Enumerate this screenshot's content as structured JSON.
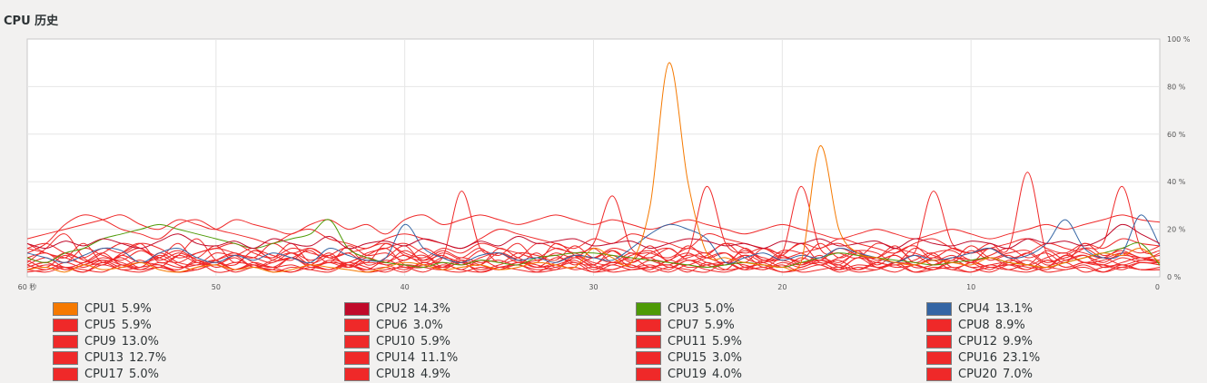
{
  "window": {
    "section_title": "CPU 历史"
  },
  "chart_data": {
    "type": "line",
    "title": "CPU 历史",
    "x_ticks": [
      "60 秒",
      "50",
      "40",
      "30",
      "20",
      "10",
      "0"
    ],
    "y_ticks": [
      "0 %",
      "20 %",
      "40 %",
      "60 %",
      "80 %",
      "100 %"
    ],
    "xlim": [
      60,
      0
    ],
    "ylim": [
      0,
      100
    ],
    "grid": true,
    "legend_position": "bottom",
    "x": [
      60,
      59,
      58,
      57,
      56,
      55,
      54,
      53,
      52,
      51,
      50,
      49,
      48,
      47,
      46,
      45,
      44,
      43,
      42,
      41,
      40,
      39,
      38,
      37,
      36,
      35,
      34,
      33,
      32,
      31,
      30,
      29,
      28,
      27,
      26,
      25,
      24,
      23,
      22,
      21,
      20,
      19,
      18,
      17,
      16,
      15,
      14,
      13,
      12,
      11,
      10,
      9,
      8,
      7,
      6,
      5,
      4,
      3,
      2,
      1,
      0
    ],
    "series": [
      {
        "name": "CPU1",
        "percent": "5.9%",
        "color": "#f57900",
        "values": [
          3,
          4,
          2,
          5,
          3,
          4,
          6,
          3,
          2,
          4,
          5,
          3,
          4,
          2,
          3,
          5,
          4,
          3,
          2,
          4,
          6,
          5,
          3,
          4,
          5,
          3,
          4,
          6,
          5,
          4,
          12,
          8,
          6,
          30,
          90,
          40,
          10,
          8,
          6,
          5,
          4,
          6,
          55,
          20,
          10,
          8,
          6,
          5,
          7,
          6,
          5,
          8,
          6,
          5,
          4,
          6,
          8,
          10,
          9,
          12,
          6
        ]
      },
      {
        "name": "CPU2",
        "percent": "14.3%",
        "color": "#c00a2a",
        "values": [
          14,
          12,
          15,
          13,
          16,
          14,
          12,
          15,
          18,
          14,
          13,
          15,
          12,
          16,
          14,
          13,
          17,
          12,
          14,
          15,
          13,
          16,
          14,
          12,
          15,
          13,
          17,
          14,
          15,
          16,
          13,
          14,
          15,
          12,
          14,
          16,
          15,
          13,
          14,
          12,
          15,
          14,
          16,
          13,
          14,
          15,
          12,
          16,
          14,
          13,
          15,
          14,
          12,
          16,
          14,
          15,
          13,
          16,
          22,
          18,
          14
        ]
      },
      {
        "name": "CPU3",
        "percent": "5.0%",
        "color": "#4e9a06",
        "values": [
          8,
          6,
          10,
          12,
          16,
          18,
          20,
          22,
          20,
          18,
          16,
          14,
          12,
          14,
          16,
          18,
          24,
          12,
          8,
          6,
          5,
          4,
          6,
          5,
          7,
          6,
          5,
          8,
          9,
          10,
          10,
          9,
          8,
          7,
          6,
          5,
          4,
          5,
          6,
          5,
          4,
          6,
          8,
          10,
          9,
          8,
          7,
          6,
          5,
          6,
          7,
          8,
          6,
          5,
          4,
          6,
          8,
          10,
          12,
          14,
          5
        ]
      },
      {
        "name": "CPU4",
        "percent": "13.1%",
        "color": "#3465a4",
        "values": [
          10,
          8,
          6,
          9,
          12,
          11,
          6,
          10,
          12,
          8,
          6,
          9,
          7,
          10,
          8,
          6,
          12,
          9,
          7,
          8,
          22,
          12,
          8,
          6,
          9,
          10,
          7,
          8,
          6,
          9,
          8,
          7,
          12,
          18,
          22,
          20,
          16,
          6,
          8,
          10,
          7,
          9,
          8,
          12,
          10,
          8,
          6,
          9,
          7,
          8,
          10,
          12,
          8,
          9,
          14,
          24,
          12,
          8,
          10,
          26,
          13
        ]
      },
      {
        "name": "CPU5",
        "percent": "5.9%",
        "color": "#ef2929",
        "values": [
          4,
          6,
          3,
          5,
          8,
          6,
          4,
          9,
          5,
          3,
          7,
          10,
          6,
          4,
          8,
          5,
          3,
          6,
          9,
          12,
          5,
          4,
          8,
          6,
          3,
          5,
          7,
          4,
          6,
          9,
          5,
          3,
          6,
          8,
          4,
          7,
          5,
          3,
          9,
          6,
          4,
          8,
          5,
          7,
          3,
          6,
          9,
          4,
          5,
          8,
          6,
          3,
          7,
          5,
          4,
          9,
          6,
          8,
          5,
          7,
          6
        ]
      },
      {
        "name": "CPU6",
        "percent": "3.0%",
        "color": "#ef2929",
        "values": [
          2,
          3,
          4,
          2,
          5,
          3,
          2,
          4,
          3,
          6,
          2,
          3,
          5,
          2,
          4,
          3,
          2,
          5,
          3,
          4,
          2,
          6,
          3,
          2,
          4,
          3,
          5,
          2,
          3,
          4,
          2,
          3,
          5,
          2,
          4,
          3,
          2,
          6,
          3,
          4,
          2,
          3,
          5,
          2,
          4,
          3,
          6,
          2,
          3,
          4,
          2,
          5,
          3,
          2,
          4,
          3,
          5,
          2,
          4,
          3,
          3
        ]
      },
      {
        "name": "CPU7",
        "percent": "5.9%",
        "color": "#ef2929",
        "values": [
          6,
          12,
          18,
          8,
          5,
          10,
          14,
          6,
          9,
          16,
          7,
          5,
          11,
          8,
          14,
          6,
          9,
          12,
          5,
          8,
          13,
          6,
          10,
          7,
          5,
          12,
          8,
          6,
          14,
          9,
          5,
          11,
          7,
          13,
          6,
          8,
          10,
          5,
          12,
          7,
          9,
          14,
          6,
          8,
          11,
          5,
          10,
          13,
          7,
          9,
          6,
          12,
          8,
          5,
          11,
          7,
          9,
          6,
          10,
          8,
          6
        ]
      },
      {
        "name": "CPU8",
        "percent": "8.9%",
        "color": "#ef2929",
        "values": [
          12,
          10,
          8,
          14,
          6,
          9,
          12,
          7,
          10,
          8,
          13,
          6,
          11,
          9,
          7,
          12,
          8,
          10,
          6,
          14,
          9,
          7,
          11,
          8,
          12,
          6,
          10,
          9,
          7,
          13,
          8,
          11,
          6,
          10,
          12,
          7,
          9,
          14,
          8,
          6,
          11,
          10,
          7,
          12,
          9,
          8,
          13,
          6,
          10,
          11,
          7,
          9,
          12,
          8,
          10,
          6,
          14,
          9,
          11,
          8,
          9
        ]
      },
      {
        "name": "CPU9",
        "percent": "13.0%",
        "color": "#ef2929",
        "values": [
          10,
          14,
          22,
          26,
          24,
          20,
          18,
          16,
          22,
          24,
          20,
          18,
          16,
          14,
          18,
          20,
          16,
          14,
          12,
          16,
          18,
          16,
          14,
          12,
          16,
          20,
          18,
          16,
          14,
          12,
          16,
          14,
          18,
          16,
          14,
          12,
          18,
          16,
          14,
          12,
          10,
          14,
          12,
          16,
          14,
          12,
          10,
          14,
          16,
          12,
          10,
          12,
          14,
          16,
          12,
          10,
          14,
          12,
          16,
          14,
          13
        ]
      },
      {
        "name": "CPU10",
        "percent": "5.9%",
        "color": "#ef2929",
        "values": [
          5,
          8,
          4,
          6,
          10,
          5,
          7,
          4,
          9,
          6,
          5,
          8,
          4,
          7,
          10,
          5,
          6,
          4,
          8,
          5,
          7,
          9,
          4,
          6,
          5,
          10,
          7,
          4,
          8,
          6,
          5,
          9,
          4,
          7,
          6,
          5,
          8,
          10,
          4,
          6,
          7,
          5,
          9,
          4,
          8,
          6,
          5,
          7,
          10,
          4,
          6,
          8,
          5,
          7,
          4,
          9,
          6,
          5,
          8,
          6,
          6
        ]
      },
      {
        "name": "CPU11",
        "percent": "5.9%",
        "color": "#ef2929",
        "values": [
          7,
          4,
          9,
          5,
          6,
          8,
          4,
          10,
          6,
          5,
          7,
          9,
          4,
          6,
          8,
          5,
          10,
          4,
          7,
          6,
          9,
          5,
          4,
          8,
          6,
          7,
          5,
          10,
          4,
          9,
          6,
          5,
          8,
          4,
          7,
          10,
          6,
          5,
          9,
          4,
          8,
          6,
          7,
          5,
          10,
          4,
          6,
          9,
          5,
          8,
          7,
          4,
          6,
          10,
          5,
          7,
          9,
          4,
          6,
          8,
          6
        ]
      },
      {
        "name": "CPU12",
        "percent": "9.9%",
        "color": "#ef2929",
        "values": [
          8,
          10,
          6,
          12,
          9,
          7,
          11,
          8,
          14,
          6,
          10,
          9,
          12,
          7,
          8,
          11,
          6,
          13,
          9,
          10,
          7,
          12,
          8,
          6,
          11,
          9,
          14,
          7,
          10,
          8,
          12,
          6,
          9,
          11,
          7,
          13,
          8,
          10,
          6,
          12,
          9,
          7,
          14,
          8,
          11,
          10,
          6,
          12,
          9,
          7,
          13,
          8,
          10,
          11,
          6,
          9,
          12,
          8,
          10,
          7,
          10
        ]
      },
      {
        "name": "CPU13",
        "percent": "12.7%",
        "color": "#ef2929",
        "values": [
          14,
          10,
          8,
          6,
          10,
          14,
          12,
          8,
          6,
          10,
          12,
          14,
          10,
          8,
          12,
          10,
          8,
          6,
          10,
          12,
          14,
          10,
          8,
          36,
          12,
          10,
          8,
          14,
          12,
          10,
          8,
          12,
          10,
          8,
          12,
          10,
          38,
          14,
          10,
          12,
          8,
          10,
          12,
          14,
          10,
          8,
          12,
          10,
          36,
          14,
          10,
          12,
          8,
          10,
          14,
          12,
          10,
          8,
          12,
          10,
          13
        ]
      },
      {
        "name": "CPU14",
        "percent": "11.1%",
        "color": "#ef2929",
        "values": [
          12,
          14,
          10,
          8,
          12,
          10,
          14,
          12,
          8,
          10,
          12,
          10,
          8,
          14,
          10,
          12,
          8,
          10,
          12,
          14,
          10,
          8,
          12,
          10,
          14,
          12,
          10,
          8,
          12,
          10,
          14,
          34,
          12,
          10,
          8,
          12,
          10,
          14,
          12,
          8,
          10,
          38,
          12,
          10,
          8,
          14,
          12,
          10,
          8,
          12,
          10,
          14,
          12,
          44,
          10,
          8,
          12,
          14,
          38,
          12,
          11
        ]
      },
      {
        "name": "CPU15",
        "percent": "3.0%",
        "color": "#ef2929",
        "values": [
          3,
          2,
          4,
          3,
          2,
          5,
          3,
          4,
          2,
          3,
          5,
          2,
          4,
          3,
          2,
          4,
          3,
          5,
          2,
          3,
          4,
          2,
          5,
          3,
          2,
          4,
          3,
          2,
          5,
          3,
          4,
          2,
          3,
          4,
          2,
          5,
          3,
          2,
          4,
          3,
          5,
          2,
          3,
          4,
          2,
          3,
          5,
          2,
          4,
          3,
          2,
          4,
          3,
          5,
          2,
          3,
          4,
          2,
          5,
          3,
          3
        ]
      },
      {
        "name": "CPU16",
        "percent": "23.1%",
        "color": "#ef2929",
        "values": [
          16,
          18,
          20,
          22,
          24,
          26,
          22,
          20,
          24,
          22,
          20,
          24,
          22,
          20,
          18,
          22,
          24,
          20,
          22,
          18,
          24,
          26,
          22,
          24,
          26,
          24,
          22,
          24,
          26,
          24,
          22,
          24,
          22,
          20,
          22,
          24,
          22,
          20,
          18,
          20,
          22,
          20,
          18,
          16,
          18,
          20,
          18,
          16,
          18,
          20,
          18,
          16,
          18,
          20,
          22,
          20,
          22,
          24,
          26,
          24,
          23
        ]
      },
      {
        "name": "CPU17",
        "percent": "5.0%",
        "color": "#ef2929",
        "values": [
          4,
          6,
          3,
          5,
          7,
          4,
          6,
          5,
          3,
          7,
          4,
          6,
          5,
          3,
          8,
          4,
          6,
          5,
          3,
          7,
          4,
          5,
          6,
          3,
          7,
          4,
          6,
          5,
          3,
          8,
          4,
          6,
          5,
          3,
          7,
          4,
          5,
          6,
          3,
          7,
          4,
          6,
          5,
          3,
          8,
          4,
          6,
          5,
          3,
          7,
          4,
          5,
          6,
          3,
          7,
          4,
          6,
          5,
          3,
          6,
          5
        ]
      },
      {
        "name": "CPU18",
        "percent": "4.9%",
        "color": "#ef2929",
        "values": [
          5,
          3,
          6,
          4,
          7,
          5,
          3,
          6,
          4,
          5,
          7,
          3,
          6,
          4,
          5,
          3,
          7,
          4,
          6,
          5,
          3,
          6,
          4,
          7,
          5,
          3,
          6,
          4,
          5,
          7,
          3,
          6,
          4,
          5,
          3,
          7,
          4,
          6,
          5,
          3,
          6,
          4,
          7,
          5,
          3,
          6,
          4,
          5,
          7,
          3,
          6,
          4,
          5,
          3,
          7,
          4,
          6,
          5,
          4,
          6,
          5
        ]
      },
      {
        "name": "CPU19",
        "percent": "4.0%",
        "color": "#ef2929",
        "values": [
          3,
          5,
          4,
          2,
          6,
          3,
          4,
          5,
          2,
          4,
          6,
          3,
          5,
          4,
          2,
          5,
          3,
          6,
          4,
          2,
          5,
          4,
          3,
          6,
          2,
          4,
          5,
          3,
          4,
          6,
          2,
          5,
          3,
          4,
          5,
          2,
          6,
          3,
          4,
          5,
          2,
          4,
          6,
          3,
          5,
          4,
          2,
          5,
          3,
          6,
          4,
          2,
          5,
          4,
          3,
          6,
          2,
          4,
          5,
          3,
          4
        ]
      },
      {
        "name": "CPU20",
        "percent": "7.0%",
        "color": "#ef2929",
        "values": [
          8,
          6,
          10,
          7,
          5,
          9,
          6,
          8,
          11,
          7,
          5,
          9,
          8,
          6,
          10,
          7,
          9,
          5,
          8,
          6,
          11,
          7,
          9,
          5,
          8,
          10,
          6,
          7,
          9,
          5,
          8,
          6,
          10,
          7,
          5,
          9,
          8,
          6,
          11,
          7,
          9,
          5,
          8,
          6,
          10,
          7,
          9,
          5,
          8,
          6,
          11,
          7,
          9,
          5,
          8,
          10,
          6,
          7,
          9,
          8,
          7
        ]
      }
    ]
  }
}
